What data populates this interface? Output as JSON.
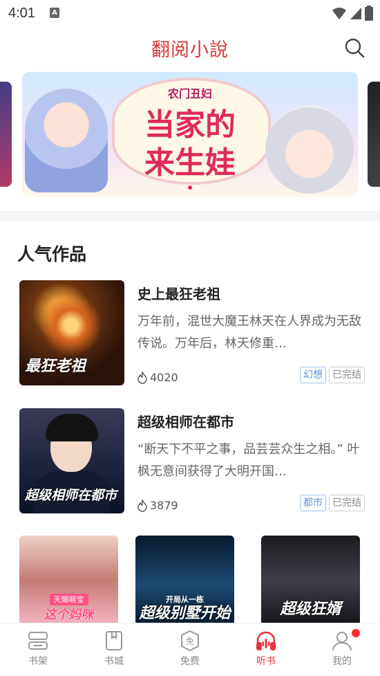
{
  "status_bar": {
    "time": "4:01",
    "notification_letter": "A"
  },
  "header": {
    "title": "翻阅小說"
  },
  "banner": {
    "subtitle": "农门丑妇",
    "title_line1": "当家的",
    "title_line2": "来生娃",
    "colors": {
      "accent": "#e02a5a"
    }
  },
  "section": {
    "title": "人气作品"
  },
  "books": [
    {
      "title": "史上最狂老祖",
      "description": "万年前，混世大魔王林天在人界成为无敌传说。万年后，林天修重…",
      "heat": "4020",
      "genre": "幻想",
      "status": "已完结",
      "cover_text": "最狂老祖"
    },
    {
      "title": "超级相师在都市",
      "description": "“断天下不平之事，品芸芸众生之相。” 叶枫无意间获得了大明开国…",
      "heat": "3879",
      "genre": "都市",
      "status": "已完结",
      "cover_text": "超级相师在都市"
    }
  ],
  "grid_books": [
    {
      "cover_badge": "天賜萌宝",
      "cover_text": "这个妈咪"
    },
    {
      "cover_sub": "开局从一栋",
      "cover_text": "超级别墅开始"
    },
    {
      "cover_text": "超级狂婿"
    }
  ],
  "bottom_nav": [
    {
      "label": "书架",
      "icon": "bookshelf-icon"
    },
    {
      "label": "书城",
      "icon": "bookstore-icon"
    },
    {
      "label": "免费",
      "icon": "free-icon"
    },
    {
      "label": "听书",
      "icon": "headphones-icon",
      "active": true
    },
    {
      "label": "我的",
      "icon": "user-icon",
      "has_badge": true
    }
  ],
  "colors": {
    "brand_red": "#d63a3a",
    "tag_blue": "#5b95d8"
  }
}
